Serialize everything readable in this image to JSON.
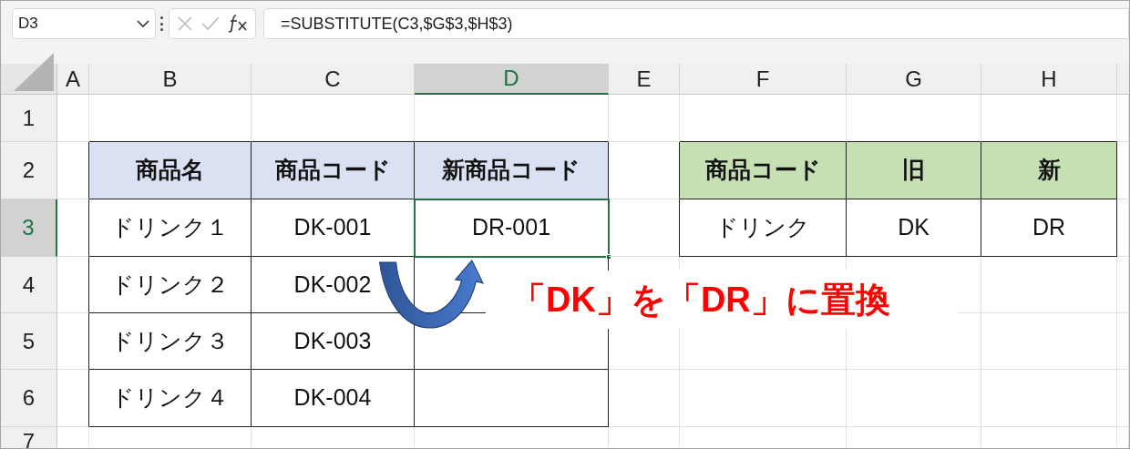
{
  "formula_bar": {
    "name_box": "D3",
    "formula": "=SUBSTITUTE(C3,$G$3,$H$3)"
  },
  "column_headers": [
    {
      "label": "A",
      "selected": false
    },
    {
      "label": "B",
      "selected": false
    },
    {
      "label": "C",
      "selected": false
    },
    {
      "label": "D",
      "selected": true
    },
    {
      "label": "E",
      "selected": false
    },
    {
      "label": "F",
      "selected": false
    },
    {
      "label": "G",
      "selected": false
    },
    {
      "label": "H",
      "selected": false
    }
  ],
  "row_headers": [
    {
      "label": "1",
      "selected": false
    },
    {
      "label": "2",
      "selected": false
    },
    {
      "label": "3",
      "selected": true
    },
    {
      "label": "4",
      "selected": false
    },
    {
      "label": "5",
      "selected": false
    },
    {
      "label": "6",
      "selected": false
    },
    {
      "label": "7",
      "selected": false
    }
  ],
  "tables": [
    {
      "color": "#d9e1f2",
      "columns": [
        "商品名",
        "商品コード",
        "新商品コード"
      ],
      "rows": [
        [
          "ドリンク１",
          "DK-001",
          "DR-001"
        ],
        [
          "ドリンク２",
          "DK-002",
          ""
        ],
        [
          "ドリンク３",
          "DK-003",
          ""
        ],
        [
          "ドリンク４",
          "DK-004",
          ""
        ]
      ]
    },
    {
      "color": "#c6e0b4",
      "columns": [
        "商品コード",
        "旧",
        "新"
      ],
      "rows": [
        [
          "ドリンク",
          "DK",
          "DR"
        ]
      ]
    }
  ],
  "callout": "「DK」を「DR」に置換"
}
